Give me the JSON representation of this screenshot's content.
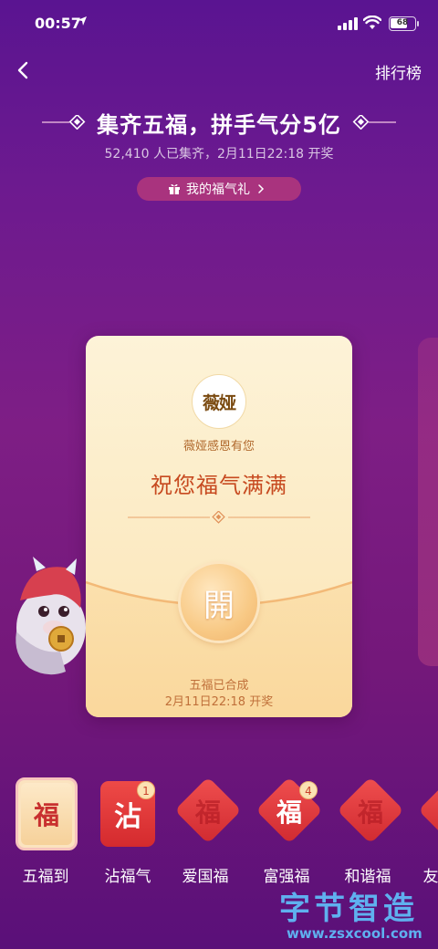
{
  "status_bar": {
    "time": "00:57",
    "battery": "68"
  },
  "nav": {
    "back_icon": "chevron-left-icon",
    "rank_label": "排行榜"
  },
  "header": {
    "title": "集齐五福，拼手气分5亿",
    "subtitle": "52,410 人已集齐，2月11日22:18 开奖",
    "gift_button_label": "我的福气礼"
  },
  "card": {
    "sponsor_logo_text": "薇娅",
    "sponsor_note": "薇娅感恩有您",
    "blessing": "祝您福气满满",
    "open_button_label": "開",
    "status": "五福已合成",
    "draw_time": "2月11日22:18 开奖"
  },
  "fu_cards": [
    {
      "label": "五福到",
      "glyph": "福",
      "active": true
    },
    {
      "label": "沾福气",
      "glyph": "沾",
      "count": "1"
    },
    {
      "label": "爱国福",
      "glyph": "福"
    },
    {
      "label": "富强福",
      "glyph": "福",
      "count": "4"
    },
    {
      "label": "和谐福",
      "glyph": "福"
    },
    {
      "label": "友"
    }
  ],
  "watermark": {
    "title": "字节智造",
    "url": "www.zsxcool.com"
  },
  "colors": {
    "background": "#6d1a8f",
    "card": "#fdf3d8",
    "accent_red": "#d42a2e",
    "blessing_text": "#c74a20"
  }
}
